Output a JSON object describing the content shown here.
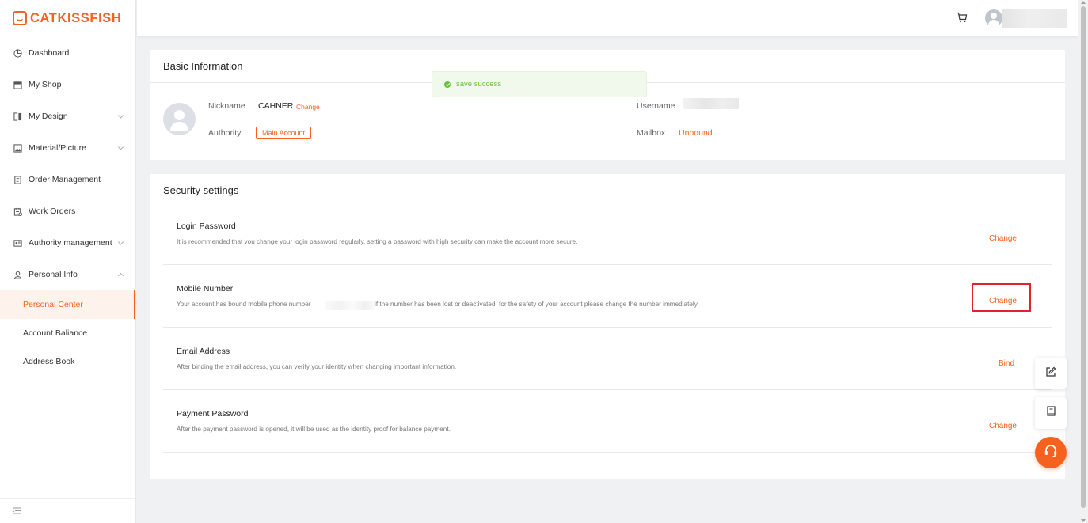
{
  "brand": {
    "name": "CATKISSFISH",
    "color": "#f5621f"
  },
  "sidebar": {
    "items": [
      {
        "label": "Dashboard",
        "icon": "dashboard-icon"
      },
      {
        "label": "My Shop",
        "icon": "shop-icon"
      },
      {
        "label": "My Design",
        "icon": "design-icon",
        "expandable": true
      },
      {
        "label": "Material/Picture",
        "icon": "picture-icon",
        "expandable": true
      },
      {
        "label": "Order Management",
        "icon": "order-icon"
      },
      {
        "label": "Work Orders",
        "icon": "work-order-icon"
      },
      {
        "label": "Authority management",
        "icon": "authority-icon",
        "expandable": true
      },
      {
        "label": "Personal Info",
        "icon": "user-icon",
        "expanded": true
      }
    ],
    "sub_items": [
      {
        "label": "Personal Center",
        "active": true
      },
      {
        "label": "Account Baliance"
      },
      {
        "label": "Address Book"
      }
    ]
  },
  "toast": {
    "message": "save success",
    "color": "#67c23a"
  },
  "basic_info": {
    "title": "Basic Information",
    "nickname_label": "Nickname",
    "nickname_value": "CAHNER",
    "nickname_change": "Change",
    "authority_label": "Authority",
    "authority_tag": "Main Account",
    "username_label": "Username",
    "mailbox_label": "Mailbox",
    "mailbox_value": "Unbound"
  },
  "security": {
    "title": "Security settings",
    "rows": [
      {
        "title": "Login Password",
        "desc": "It is recommended that you change your login password regularly, setting a password with high security can make the account more secure.",
        "action": "Change"
      },
      {
        "title": "Mobile Number",
        "desc_before": "Your account has bound mobile phone number",
        "desc_after": ", if the number has been lost or deactivated, for the safety of your account please change the number immediately.",
        "action": "Change",
        "highlighted": true
      },
      {
        "title": "Email Address",
        "desc": "After binding the email address, you can verify your identity when changing important information.",
        "action": "Bind"
      },
      {
        "title": "Payment Password",
        "desc": "After the payment password is opened, it will be used as the identity proof for balance payment.",
        "action": "Change"
      }
    ]
  },
  "floating": [
    "edit-icon",
    "manual-icon",
    "headset-icon"
  ],
  "header_icons": [
    "cart-icon",
    "avatar"
  ]
}
